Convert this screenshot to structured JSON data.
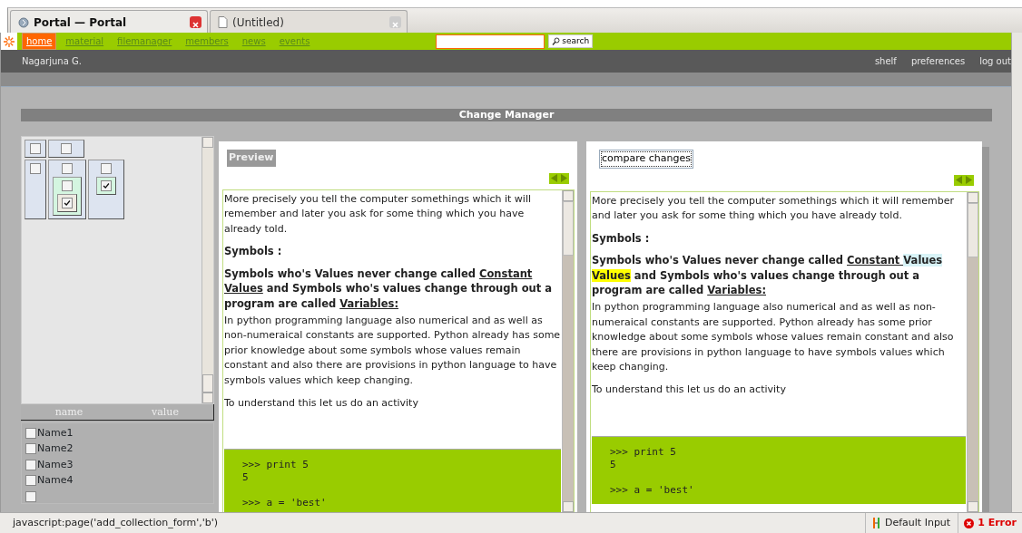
{
  "browser_tabs": [
    {
      "title": "Portal — Portal",
      "selected": true
    },
    {
      "title": "(Untitled)",
      "selected": false
    }
  ],
  "nav": {
    "items": [
      {
        "label": "home",
        "selected": true
      },
      {
        "label": "material",
        "selected": false
      },
      {
        "label": "filemanager",
        "selected": false
      },
      {
        "label": "members",
        "selected": false
      },
      {
        "label": "news",
        "selected": false
      },
      {
        "label": "events",
        "selected": false
      }
    ],
    "search_button": "search"
  },
  "user_bar": {
    "user": "Nagarjuna G.",
    "links": [
      "shelf",
      "preferences",
      "log out"
    ]
  },
  "title": "Change Manager",
  "tree": {
    "rows": [
      [
        {
          "checked": false
        },
        {
          "checked": false
        }
      ],
      [
        {
          "checked": false
        },
        {
          "checked": false,
          "children": [
            {
              "checked": false,
              "children": [
                {
                  "checked": true
                }
              ]
            }
          ]
        },
        {
          "checked": false,
          "children": [
            {
              "checked": true
            }
          ]
        }
      ]
    ]
  },
  "attributes": {
    "columns": [
      "name",
      "value"
    ],
    "rows": [
      {
        "name": "Name1",
        "checked": false
      },
      {
        "name": "Name2",
        "checked": false
      },
      {
        "name": "Name3",
        "checked": false
      },
      {
        "name": "Name4",
        "checked": false
      },
      {
        "checked": false
      }
    ]
  },
  "preview": {
    "label": "Preview",
    "blocks": [
      {
        "kind": "text",
        "text": "More precisely you tell the computer somethings which it will remember and later you ask for some thing which you have already told."
      },
      {
        "kind": "heading",
        "text": "Symbols :"
      },
      {
        "kind": "rich",
        "segments": [
          {
            "text": "Symbols who's Values never change called ",
            "kind": "plain"
          },
          {
            "text": "Constant Values",
            "kind": "underlined"
          },
          {
            "text": " and Symbols who's values change through out a program are called ",
            "kind": "plain"
          },
          {
            "text": "Variables:",
            "kind": "underlined"
          }
        ]
      },
      {
        "kind": "text",
        "text": "In python programming language also numerical and as well as non-numeraical constants are supported. Python already has some prior knowledge about some symbols whose values remain constant and also there are provisions in python language to have symbols values which keep changing."
      },
      {
        "kind": "text",
        "text": "To understand this let us do an activity"
      },
      {
        "kind": "code",
        "groups": [
          [
            ">>> print 5",
            "5"
          ],
          [
            ">>> a = 'best'"
          ]
        ]
      }
    ]
  },
  "compare": {
    "button": "compare changes",
    "blocks": [
      {
        "kind": "text",
        "text": "More precisely you tell the computer somethings which it will remember and later you ask for some thing which you have already told."
      },
      {
        "kind": "heading",
        "text": "Symbols :"
      },
      {
        "kind": "rich",
        "segments": [
          {
            "text": "Symbols who's Values never change called ",
            "kind": "plain"
          },
          {
            "text": "Constant ",
            "kind": "underlined"
          },
          {
            "text": "Values ",
            "kind": "removed"
          },
          {
            "text": "Values",
            "kind": "added"
          },
          {
            "text": " and Symbols who's values change through out a program are called ",
            "kind": "plain"
          },
          {
            "text": "Variables:",
            "kind": "underlined"
          }
        ]
      },
      {
        "kind": "text",
        "text": "In python programming language also numerical and as well as non-numeraical constants are supported. Python already has some prior knowledge about some symbols whose values remain constant and also there are provisions in python language to have symbols values which keep changing."
      },
      {
        "kind": "text",
        "text": "To understand this let us do an activity"
      },
      {
        "kind": "code",
        "groups": [
          [
            ">>> print 5",
            "5"
          ],
          [
            ">>> a = 'best'"
          ]
        ]
      }
    ]
  },
  "status_bar": {
    "text": "javascript:page('add_collection_form','b')",
    "input": "Default Input",
    "errors": "1 Error"
  }
}
